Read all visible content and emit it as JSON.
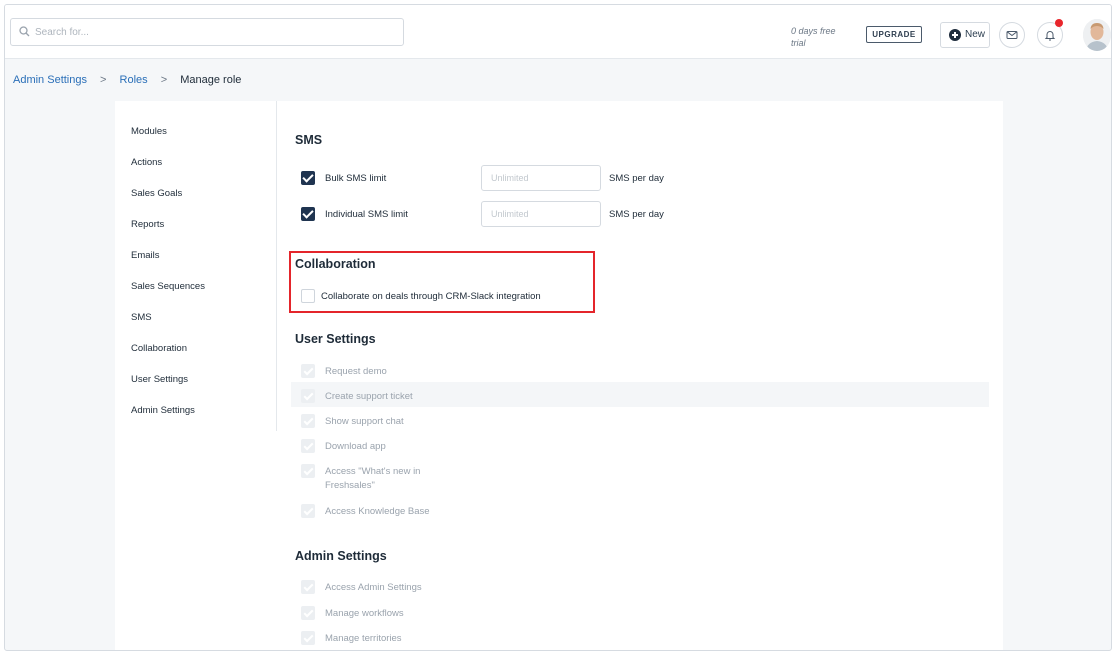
{
  "topbar": {
    "search_placeholder": "Search for...",
    "trial_text": "0 days free trial",
    "upgrade_label": "UPGRADE",
    "new_label": "New"
  },
  "breadcrumb": {
    "items": [
      "Admin Settings",
      "Roles",
      "Manage role"
    ],
    "separator": ">"
  },
  "nav": {
    "items": [
      "Modules",
      "Actions",
      "Sales Goals",
      "Reports",
      "Emails",
      "Sales Sequences",
      "SMS",
      "Collaboration",
      "User Settings",
      "Admin Settings"
    ]
  },
  "sms": {
    "title": "SMS",
    "rows": [
      {
        "label": "Bulk SMS limit",
        "checked": true,
        "placeholder": "Unlimited",
        "unit": "SMS per day"
      },
      {
        "label": "Individual SMS limit",
        "checked": true,
        "placeholder": "Unlimited",
        "unit": "SMS per day"
      }
    ]
  },
  "collaboration": {
    "title": "Collaboration",
    "option": "Collaborate on deals through CRM-Slack integration",
    "checked": false
  },
  "user_settings": {
    "title": "User Settings",
    "items": [
      "Request demo",
      "Create support ticket",
      "Show support chat",
      "Download app",
      "Access \"What's new in",
      "Freshsales\"",
      "Access Knowledge Base"
    ]
  },
  "admin_settings": {
    "title": "Admin Settings",
    "items": [
      "Access Admin Settings",
      "Manage workflows",
      "Manage territories"
    ]
  },
  "colors": {
    "accent": "#2a6fb8",
    "checkbox": "#1f3450",
    "highlight": "#e4252b",
    "notification": "#e8262c"
  }
}
